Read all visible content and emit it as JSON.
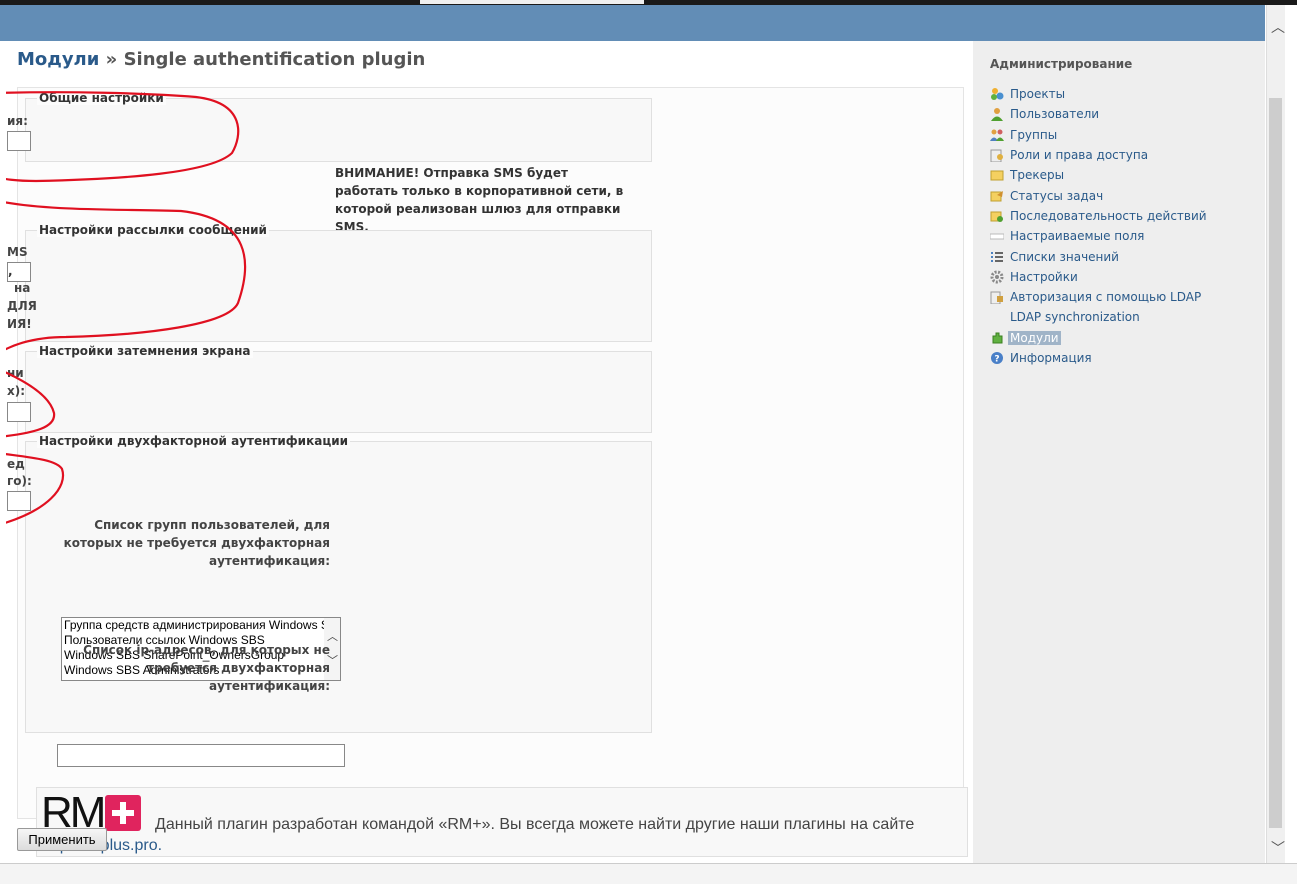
{
  "breadcrumb": {
    "parent_link": "Модули",
    "separator": "»",
    "current": "Single authentification plugin"
  },
  "sections": {
    "general": {
      "legend": "Общие настройки",
      "cut_label": "ия:"
    },
    "sms_warning": "ВНИМАНИЕ! Отправка SMS будет работать только в корпоративной сети, в которой реализован шлюз для отправки SMS.",
    "mailing": {
      "legend": "Настройки рассылки сообщений",
      "cut_lines": [
        "MS",
        ", не",
        "на",
        "ДЛЯ",
        "ИЯ!"
      ]
    },
    "dimming": {
      "legend": "Настройки затемнения экрана",
      "cut_lines": [
        "ни",
        "х):"
      ]
    },
    "two_factor": {
      "legend": "Настройки двухфакторной аутентификации",
      "cut_lines": [
        "ед",
        "го):"
      ],
      "groups_label": "Список групп пользователей, для которых не требуется двухфакторная аутентификация:",
      "groups_options": [
        "Группа средств администрирования Windows SBS",
        "Пользователи ссылок Windows SBS",
        "Windows SBS SharePoint_OwnersGroup",
        "Windows SBS Administrators"
      ],
      "ip_label": "Список ip-адресов, для которых не требуется двухфакторная аутентификация:",
      "ip_value": ""
    }
  },
  "banner": {
    "logo_text": "RM",
    "text": "Данный плагин разработан командой «RM+». Вы всегда можете найти другие наши плагины на сайте",
    "link": "http://rmplus.pro."
  },
  "apply_button": "Применить",
  "sidebar": {
    "title": "Администрирование",
    "items": [
      {
        "label": "Проекты",
        "icon": "projects-icon"
      },
      {
        "label": "Пользователи",
        "icon": "user-icon"
      },
      {
        "label": "Группы",
        "icon": "group-icon"
      },
      {
        "label": "Роли и права доступа",
        "icon": "roles-icon"
      },
      {
        "label": "Трекеры",
        "icon": "tracker-icon"
      },
      {
        "label": "Статусы задач",
        "icon": "issue-status-icon"
      },
      {
        "label": "Последовательность действий",
        "icon": "workflow-icon"
      },
      {
        "label": "Настраиваемые поля",
        "icon": "custom-fields-icon"
      },
      {
        "label": "Списки значений",
        "icon": "list-icon"
      },
      {
        "label": "Настройки",
        "icon": "gear-icon"
      },
      {
        "label": "Авторизация с помощью LDAP",
        "icon": "ldap-icon"
      },
      {
        "label": "LDAP synchronization",
        "icon": "sync-icon"
      },
      {
        "label": "Модули",
        "icon": "plugin-icon",
        "selected": true
      },
      {
        "label": "Информация",
        "icon": "info-icon"
      }
    ]
  },
  "colors": {
    "header": "#628db6",
    "link": "#2a5a8a",
    "selected_bg": "#a0b4c8",
    "annotation": "#e01020"
  }
}
